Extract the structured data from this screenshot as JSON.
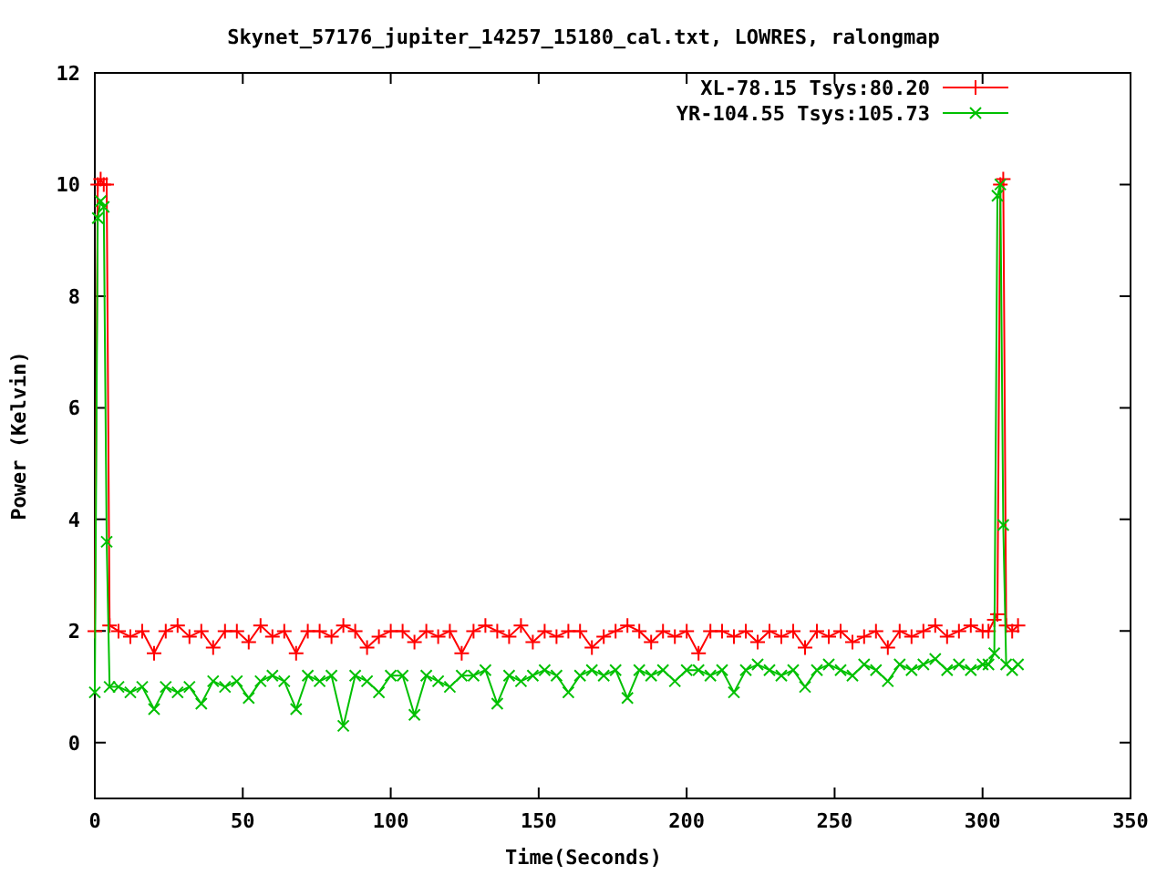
{
  "chart": {
    "chart_data": {
      "type": "line",
      "title": "Skynet_57176_jupiter_14257_15180_cal.txt, LOWRES, ralongmap",
      "xlabel": "Time(Seconds)",
      "ylabel": "Power (Kelvin)",
      "x": [
        0,
        1,
        2,
        3,
        4,
        5,
        8,
        12,
        16,
        20,
        24,
        28,
        32,
        36,
        40,
        44,
        48,
        52,
        56,
        60,
        64,
        68,
        72,
        76,
        80,
        84,
        88,
        92,
        96,
        100,
        104,
        108,
        112,
        116,
        120,
        124,
        128,
        132,
        136,
        140,
        144,
        148,
        152,
        156,
        160,
        164,
        168,
        172,
        176,
        180,
        184,
        188,
        192,
        196,
        200,
        204,
        208,
        212,
        216,
        220,
        224,
        228,
        232,
        236,
        240,
        244,
        248,
        252,
        256,
        260,
        264,
        268,
        272,
        276,
        280,
        284,
        288,
        292,
        296,
        300,
        302,
        304,
        305,
        306,
        307,
        308,
        310,
        312
      ],
      "series": [
        {
          "name": "XL-78.15 Tsys:80.20",
          "color": "#ff0000",
          "marker": "plus",
          "values": [
            2.0,
            10.0,
            10.1,
            10.0,
            10.0,
            2.1,
            2.0,
            1.9,
            2.0,
            1.6,
            2.0,
            2.1,
            1.9,
            2.0,
            1.7,
            2.0,
            2.0,
            1.8,
            2.1,
            1.9,
            2.0,
            1.6,
            2.0,
            2.0,
            1.9,
            2.1,
            2.0,
            1.7,
            1.9,
            2.0,
            2.0,
            1.8,
            2.0,
            1.9,
            2.0,
            1.6,
            2.0,
            2.1,
            2.0,
            1.9,
            2.1,
            1.8,
            2.0,
            1.9,
            2.0,
            2.0,
            1.7,
            1.9,
            2.0,
            2.1,
            2.0,
            1.8,
            2.0,
            1.9,
            2.0,
            1.6,
            2.0,
            2.0,
            1.9,
            2.0,
            1.8,
            2.0,
            1.9,
            2.0,
            1.7,
            2.0,
            1.9,
            2.0,
            1.8,
            1.9,
            2.0,
            1.7,
            2.0,
            1.9,
            2.0,
            2.1,
            1.9,
            2.0,
            2.1,
            2.0,
            2.0,
            2.2,
            2.3,
            10.0,
            10.1,
            2.1,
            2.0,
            2.1
          ]
        },
        {
          "name": "YR-104.55 Tsys:105.73",
          "color": "#00c000",
          "marker": "cross",
          "values": [
            0.9,
            9.4,
            9.7,
            9.6,
            3.6,
            1.0,
            1.0,
            0.9,
            1.0,
            0.6,
            1.0,
            0.9,
            1.0,
            0.7,
            1.1,
            1.0,
            1.1,
            0.8,
            1.1,
            1.2,
            1.1,
            0.6,
            1.2,
            1.1,
            1.2,
            0.3,
            1.2,
            1.1,
            0.9,
            1.2,
            1.2,
            0.5,
            1.2,
            1.1,
            1.0,
            1.2,
            1.2,
            1.3,
            0.7,
            1.2,
            1.1,
            1.2,
            1.3,
            1.2,
            0.9,
            1.2,
            1.3,
            1.2,
            1.3,
            0.8,
            1.3,
            1.2,
            1.3,
            1.1,
            1.3,
            1.3,
            1.2,
            1.3,
            0.9,
            1.3,
            1.4,
            1.3,
            1.2,
            1.3,
            1.0,
            1.3,
            1.4,
            1.3,
            1.2,
            1.4,
            1.3,
            1.1,
            1.4,
            1.3,
            1.4,
            1.5,
            1.3,
            1.4,
            1.3,
            1.4,
            1.4,
            1.6,
            9.8,
            10.0,
            3.9,
            1.4,
            1.3,
            1.4
          ]
        }
      ],
      "legend": "top-right",
      "xlim": [
        0,
        350
      ],
      "ylim": [
        -1,
        12
      ],
      "xticks": [
        0,
        50,
        100,
        150,
        200,
        250,
        300,
        350
      ],
      "yticks": [
        0,
        2,
        4,
        6,
        8,
        10,
        12
      ]
    }
  }
}
